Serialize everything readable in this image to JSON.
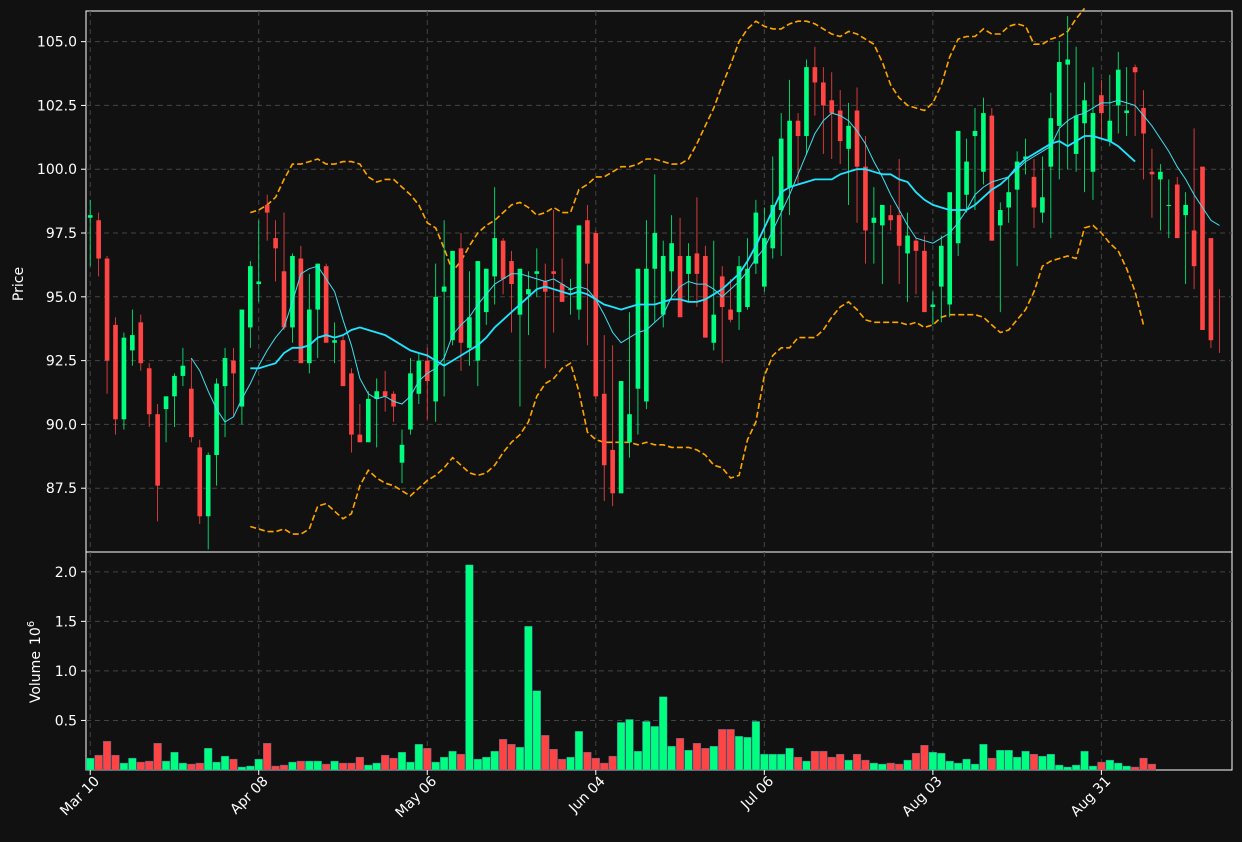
{
  "chart_data": {
    "type": "candlestick",
    "ylabel_price": "Price",
    "ylabel_volume": "Volume",
    "volume_exponent_base": "10",
    "volume_exponent_power": "6",
    "x_tick_labels": [
      "Mar 10",
      "Apr 08",
      "May 06",
      "Jun 04",
      "Jul 06",
      "Aug 03",
      "Aug 31"
    ],
    "x_tick_index": [
      0,
      20,
      40,
      60,
      80,
      100,
      120
    ],
    "price_ylim": [
      85.0,
      106.2
    ],
    "price_ticks": [
      87.5,
      90.0,
      92.5,
      95.0,
      97.5,
      100.0,
      102.5,
      105.0
    ],
    "volume_ylim": [
      0,
      2.2
    ],
    "volume_ticks": [
      0.5,
      1.0,
      1.5,
      2.0
    ],
    "grid": true,
    "colors": {
      "background": "#111111",
      "up": "#00ff7f",
      "down": "#ff4444",
      "ma_fast": "#40e0f0",
      "ma_slow": "#22e4ff",
      "bollinger": "#ffa500",
      "grid": "#444444",
      "axis": "#ffffff"
    },
    "candles": {
      "open": [
        98.1,
        98.0,
        96.5,
        93.9,
        90.2,
        92.9,
        94.0,
        92.2,
        90.4,
        90.6,
        91.1,
        91.9,
        91.4,
        89.1,
        86.4,
        88.8,
        91.5,
        92.5,
        90.7,
        93.8,
        95.5,
        98.6,
        97.3,
        96.0,
        93.8,
        96.5,
        92.4,
        94.5,
        96.2,
        93.2,
        93.3,
        92.0,
        89.6,
        89.3,
        91.0,
        91.3,
        91.2,
        88.5,
        89.8,
        91.2,
        92.5,
        90.9,
        95.2,
        93.3,
        96.9,
        93.0,
        92.5,
        94.4,
        95.8,
        97.2,
        96.4,
        94.3,
        95.1,
        95.9,
        95.6,
        96.0,
        95.5,
        95.3,
        94.5,
        98.0,
        97.5,
        91.2,
        89.0,
        87.3,
        89.3,
        91.4,
        90.9,
        96.1,
        94.3,
        96.0,
        96.6,
        95.9,
        96.7,
        96.6,
        93.2,
        95.8,
        94.5,
        94.4,
        94.6,
        96.3,
        95.4,
        96.9,
        98.4,
        99.3,
        101.9,
        101.3,
        104.0,
        103.4,
        102.7,
        102.3,
        100.8,
        102.3,
        100.1,
        97.9,
        97.8,
        98.2,
        98.2,
        96.7,
        97.2,
        96.8,
        94.6,
        95.4,
        94.7,
        97.1,
        99.0,
        101.3,
        99.9,
        102.1,
        97.8,
        98.5,
        99.2,
        100.4,
        99.7,
        98.3,
        100.1,
        101.7,
        104.1,
        100.6,
        101.8,
        99.9,
        102.9,
        101.1,
        102.5,
        102.2,
        104.0,
        102.4,
        99.9,
        99.6,
        98.6,
        99.4,
        98.2,
        97.6,
        100.1,
        97.3,
        95.2,
        93.8
      ],
      "high": [
        98.8,
        98.3,
        96.6,
        94.2,
        93.6,
        94.5,
        94.3,
        92.4,
        90.8,
        91.0,
        92.0,
        93.0,
        92.6,
        89.4,
        88.9,
        91.8,
        93.0,
        93.0,
        92.8,
        96.4,
        98.0,
        99.0,
        98.0,
        98.3,
        96.7,
        97.0,
        95.9,
        96.3,
        96.3,
        94.0,
        93.5,
        92.2,
        90.8,
        91.3,
        91.8,
        92.1,
        91.3,
        89.8,
        92.6,
        92.8,
        93.0,
        96.3,
        98.0,
        96.1,
        97.5,
        96.0,
        94.1,
        95.9,
        99.3,
        97.3,
        96.8,
        95.1,
        96.0,
        96.9,
        96.3,
        98.4,
        96.5,
        95.7,
        96.8,
        98.6,
        97.6,
        93.5,
        93.1,
        91.4,
        94.4,
        92.2,
        98.0,
        99.8,
        97.2,
        98.2,
        98.1,
        97.1,
        98.9,
        97.0,
        97.2,
        96.2,
        95.7,
        96.6,
        97.3,
        98.8,
        98.5,
        100.5,
        102.2,
        103.5,
        102.2,
        104.3,
        104.8,
        104.0,
        103.8,
        103.1,
        102.6,
        103.2,
        101.3,
        99.3,
        98.3,
        98.6,
        100.4,
        98.3,
        97.3,
        97.4,
        95.2,
        97.4,
        97.8,
        100.1,
        101.2,
        102.4,
        102.8,
        102.4,
        98.7,
        99.7,
        100.7,
        101.2,
        100.4,
        100.5,
        103.0,
        105.0,
        106.0,
        104.8,
        103.4,
        104.0,
        103.5,
        103.7,
        104.6,
        104.0,
        104.1,
        103.1,
        100.8,
        100.2,
        99.6,
        99.7,
        99.1,
        101.6,
        98.2,
        96.1,
        95.3
      ],
      "low": [
        96.2,
        95.8,
        91.2,
        89.6,
        89.8,
        92.3,
        92.1,
        89.9,
        86.2,
        89.3,
        89.9,
        91.5,
        89.3,
        86.1,
        85.1,
        87.6,
        89.5,
        90.3,
        90.0,
        93.0,
        94.8,
        97.2,
        95.6,
        93.7,
        93.2,
        92.6,
        92.0,
        92.6,
        93.6,
        92.4,
        92.4,
        88.9,
        89.3,
        89.7,
        89.1,
        90.5,
        90.1,
        87.7,
        89.6,
        90.8,
        90.2,
        90.1,
        91.1,
        93.1,
        92.1,
        92.3,
        91.5,
        93.9,
        94.7,
        95.1,
        93.6,
        90.7,
        93.5,
        95.0,
        92.2,
        93.6,
        94.9,
        94.3,
        94.1,
        93.1,
        91.0,
        87.0,
        86.8,
        88.2,
        88.7,
        89.6,
        90.6,
        94.0,
        93.8,
        94.9,
        94.7,
        94.8,
        94.6,
        94.0,
        92.9,
        92.4,
        94.0,
        93.7,
        94.5,
        95.9,
        95.2,
        96.5,
        96.6,
        98.2,
        99.4,
        100.6,
        102.1,
        100.6,
        100.4,
        100.2,
        98.6,
        97.9,
        96.3,
        96.3,
        95.5,
        97.6,
        95.5,
        94.8,
        95.1,
        94.6,
        93.9,
        94.0,
        94.2,
        96.6,
        98.3,
        98.4,
        99.4,
        98.3,
        94.4,
        97.9,
        96.2,
        99.8,
        97.7,
        97.9,
        97.3,
        99.6,
        100.0,
        99.9,
        99.1,
        98.8,
        101.2,
        100.9,
        101.4,
        101.3,
        101.3,
        99.6,
        98.1,
        97.6,
        97.3,
        97.3,
        95.5,
        95.3,
        94.1,
        93.0,
        92.8
      ],
      "close": [
        98.2,
        96.5,
        92.5,
        90.2,
        93.4,
        93.5,
        92.4,
        90.4,
        87.6,
        91.1,
        91.9,
        92.3,
        89.5,
        86.4,
        88.8,
        91.6,
        92.6,
        92.0,
        94.5,
        96.2,
        95.6,
        98.3,
        96.9,
        93.8,
        96.6,
        92.4,
        94.5,
        96.3,
        93.2,
        93.3,
        91.5,
        89.6,
        89.3,
        91.0,
        91.3,
        91.1,
        90.7,
        89.2,
        92.0,
        92.5,
        91.7,
        95.0,
        95.4,
        96.8,
        93.2,
        94.2,
        96.4,
        96.1,
        97.3,
        95.7,
        95.5,
        96.1,
        95.3,
        96.0,
        95.2,
        95.9,
        94.8,
        95.3,
        97.8,
        96.3,
        91.1,
        88.4,
        87.3,
        91.7,
        90.4,
        96.1,
        96.1,
        97.5,
        96.6,
        97.1,
        94.2,
        96.6,
        95.9,
        93.4,
        94.3,
        94.6,
        94.1,
        96.2,
        96.1,
        98.3,
        97.3,
        98.6,
        101.2,
        101.9,
        101.3,
        104.0,
        103.4,
        102.5,
        102.2,
        101.1,
        101.7,
        100.1,
        97.6,
        98.1,
        98.6,
        98.0,
        97.0,
        97.4,
        96.8,
        94.4,
        94.7,
        97.0,
        99.1,
        101.5,
        100.3,
        101.5,
        102.2,
        97.2,
        98.4,
        99.1,
        100.3,
        100.5,
        98.5,
        98.9,
        102.0,
        104.2,
        104.3,
        102.1,
        102.7,
        102.2,
        102.2,
        101.9,
        103.9,
        102.3,
        103.8,
        101.4,
        99.8,
        99.9,
        98.6,
        97.3,
        98.6,
        96.2,
        93.7,
        93.3
      ]
    },
    "ma_fast": [
      null,
      null,
      null,
      null,
      null,
      null,
      null,
      null,
      null,
      null,
      null,
      null,
      92.6,
      92.1,
      91.3,
      90.6,
      90.1,
      90.3,
      91.0,
      91.6,
      92.3,
      92.9,
      93.4,
      93.8,
      94.8,
      95.9,
      96.1,
      96.2,
      95.7,
      95.2,
      94.1,
      93.1,
      91.8,
      91.2,
      91.0,
      91.1,
      90.9,
      90.8,
      91.1,
      91.7,
      92.0,
      92.2,
      92.6,
      93.5,
      93.9,
      94.2,
      94.7,
      95.1,
      95.5,
      95.7,
      95.9,
      95.9,
      95.8,
      95.7,
      95.6,
      95.7,
      95.5,
      95.3,
      95.4,
      95.3,
      94.9,
      94.3,
      93.6,
      93.2,
      93.4,
      93.6,
      93.7,
      94.0,
      94.3,
      95.0,
      95.4,
      95.6,
      95.5,
      95.5,
      95.3,
      95.0,
      95.3,
      95.6,
      96.0,
      96.5,
      96.9,
      97.6,
      98.3,
      99.0,
      99.8,
      100.6,
      101.4,
      101.9,
      102.2,
      102.1,
      101.9,
      101.5,
      101.0,
      100.3,
      99.7,
      99.0,
      98.4,
      97.8,
      97.3,
      97.2,
      97.1,
      97.3,
      97.5,
      97.9,
      98.4,
      99.0,
      99.3,
      99.5,
      99.6,
      99.7,
      100.0,
      100.3,
      100.5,
      100.7,
      100.9,
      101.6,
      101.9,
      102.1,
      102.2,
      102.4,
      102.6,
      102.6,
      102.7,
      102.6,
      102.5,
      102.1,
      101.7,
      101.2,
      100.7,
      100.1,
      99.6,
      99.0,
      98.5,
      98.0,
      97.8
    ],
    "ma_slow": [
      null,
      null,
      null,
      null,
      null,
      null,
      null,
      null,
      null,
      null,
      null,
      null,
      null,
      null,
      null,
      null,
      null,
      null,
      null,
      92.2,
      92.2,
      92.3,
      92.4,
      92.8,
      93.0,
      93.0,
      93.1,
      93.4,
      93.5,
      93.4,
      93.5,
      93.7,
      93.8,
      93.7,
      93.6,
      93.5,
      93.3,
      93.1,
      92.9,
      92.8,
      92.7,
      92.5,
      92.3,
      92.5,
      92.7,
      92.9,
      93.1,
      93.4,
      93.8,
      94.1,
      94.4,
      94.7,
      95.0,
      95.3,
      95.4,
      95.3,
      95.2,
      95.1,
      95.2,
      95.1,
      94.9,
      94.7,
      94.6,
      94.5,
      94.6,
      94.7,
      94.7,
      94.7,
      94.8,
      94.9,
      94.9,
      94.8,
      94.8,
      94.9,
      95.1,
      95.3,
      95.6,
      95.9,
      96.4,
      97.0,
      97.7,
      98.4,
      99.1,
      99.3,
      99.4,
      99.5,
      99.6,
      99.6,
      99.6,
      99.8,
      99.9,
      100.0,
      100.0,
      99.9,
      99.8,
      99.8,
      99.6,
      99.5,
      99.1,
      98.8,
      98.6,
      98.5,
      98.4,
      98.4,
      98.4,
      98.6,
      98.9,
      99.2,
      99.4,
      99.7,
      100.1,
      100.4,
      100.6,
      100.8,
      101.0,
      101.1,
      100.9,
      101.1,
      101.3,
      101.3,
      101.2,
      101.1,
      100.9,
      100.6,
      100.3
    ],
    "bb_upper": [
      null,
      null,
      null,
      null,
      null,
      null,
      null,
      null,
      null,
      null,
      null,
      null,
      null,
      null,
      null,
      null,
      null,
      null,
      null,
      98.3,
      98.4,
      98.6,
      98.9,
      99.6,
      100.2,
      100.2,
      100.3,
      100.4,
      100.2,
      100.2,
      100.3,
      100.3,
      100.2,
      99.7,
      99.5,
      99.6,
      99.6,
      99.3,
      99.0,
      98.6,
      97.9,
      97.7,
      96.9,
      96.0,
      96.4,
      97.0,
      97.5,
      97.8,
      98.0,
      98.3,
      98.6,
      98.7,
      98.5,
      98.2,
      98.3,
      98.5,
      98.3,
      98.3,
      99.2,
      99.4,
      99.7,
      99.7,
      99.9,
      100.1,
      100.1,
      100.2,
      100.4,
      100.4,
      100.3,
      100.2,
      100.2,
      100.4,
      101.0,
      101.7,
      102.4,
      103.3,
      104.1,
      105.0,
      105.5,
      105.8,
      105.6,
      105.5,
      105.5,
      105.7,
      105.8,
      105.8,
      105.7,
      105.5,
      105.3,
      105.2,
      105.4,
      105.3,
      105.1,
      104.9,
      104.2,
      103.3,
      102.8,
      102.5,
      102.4,
      102.3,
      102.6,
      103.3,
      104.4,
      105.1,
      105.2,
      105.2,
      105.5,
      105.3,
      105.3,
      105.6,
      105.7,
      105.6,
      104.9,
      104.9,
      105.1,
      105.2,
      105.4,
      105.9,
      106.3
    ],
    "bb_lower": [
      null,
      null,
      null,
      null,
      null,
      null,
      null,
      null,
      null,
      null,
      null,
      null,
      null,
      null,
      null,
      null,
      null,
      null,
      null,
      86.0,
      85.9,
      85.8,
      85.8,
      85.9,
      85.7,
      85.7,
      85.9,
      86.8,
      86.9,
      86.6,
      86.3,
      86.5,
      87.6,
      88.2,
      87.9,
      87.7,
      87.6,
      87.4,
      87.2,
      87.5,
      87.8,
      88.0,
      88.3,
      88.7,
      88.4,
      88.1,
      88.0,
      88.1,
      88.4,
      88.9,
      89.3,
      89.6,
      90.1,
      91.1,
      91.6,
      91.8,
      92.2,
      92.4,
      91.3,
      89.7,
      89.4,
      89.3,
      89.3,
      89.3,
      89.3,
      89.2,
      89.3,
      89.2,
      89.2,
      89.1,
      89.1,
      89.1,
      89.0,
      88.8,
      88.4,
      88.3,
      87.9,
      88.0,
      89.4,
      90.1,
      91.9,
      92.7,
      93.0,
      93.0,
      93.4,
      93.4,
      93.4,
      93.7,
      94.2,
      94.6,
      94.8,
      94.5,
      94.1,
      94.0,
      94.0,
      94.0,
      94.0,
      93.9,
      94.0,
      93.8,
      93.9,
      94.2,
      94.3,
      94.3,
      94.3,
      94.3,
      94.2,
      93.9,
      93.6,
      93.7,
      94.1,
      94.5,
      95.2,
      96.2,
      96.4,
      96.5,
      96.6,
      96.5,
      97.7,
      97.8,
      97.5,
      97.1,
      96.8,
      96.1,
      95.2,
      93.9
    ],
    "volume": [
      0.12,
      0.15,
      0.29,
      0.15,
      0.07,
      0.12,
      0.08,
      0.09,
      0.27,
      0.09,
      0.18,
      0.07,
      0.06,
      0.07,
      0.22,
      0.08,
      0.14,
      0.11,
      0.03,
      0.04,
      0.11,
      0.27,
      0.04,
      0.05,
      0.08,
      0.09,
      0.09,
      0.09,
      0.06,
      0.09,
      0.07,
      0.07,
      0.13,
      0.05,
      0.07,
      0.15,
      0.12,
      0.18,
      0.08,
      0.26,
      0.22,
      0.08,
      0.13,
      0.19,
      0.16,
      2.07,
      0.11,
      0.13,
      0.19,
      0.31,
      0.26,
      0.23,
      1.45,
      0.8,
      0.35,
      0.21,
      0.11,
      0.13,
      0.39,
      0.18,
      0.12,
      0.07,
      0.14,
      0.48,
      0.51,
      0.19,
      0.49,
      0.44,
      0.74,
      0.24,
      0.32,
      0.2,
      0.27,
      0.22,
      0.24,
      0.41,
      0.41,
      0.34,
      0.33,
      0.49,
      0.16,
      0.16,
      0.16,
      0.22,
      0.13,
      0.09,
      0.19,
      0.19,
      0.13,
      0.16,
      0.1,
      0.16,
      0.1,
      0.07,
      0.06,
      0.07,
      0.06,
      0.1,
      0.17,
      0.25,
      0.18,
      0.17,
      0.09,
      0.07,
      0.11,
      0.06,
      0.26,
      0.12,
      0.2,
      0.2,
      0.13,
      0.19,
      0.16,
      0.14,
      0.16,
      0.05,
      0.03,
      0.05,
      0.19,
      0.04,
      0.08,
      0.1,
      0.07,
      0.04,
      0.03,
      0.12,
      0.06
    ]
  }
}
